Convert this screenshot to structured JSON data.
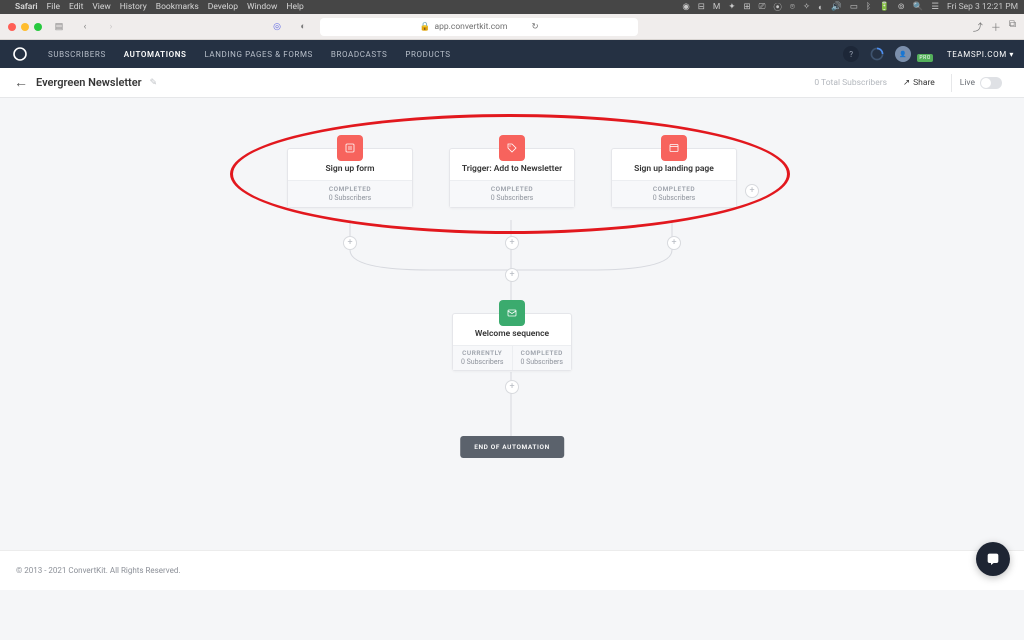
{
  "mac": {
    "app": "Safari",
    "menus": [
      "File",
      "Edit",
      "View",
      "History",
      "Bookmarks",
      "Develop",
      "Window",
      "Help"
    ],
    "clock": "Fri Sep 3  12:21 PM"
  },
  "browser": {
    "url": "app.convertkit.com"
  },
  "nav": {
    "items": [
      "SUBSCRIBERS",
      "AUTOMATIONS",
      "LANDING PAGES & FORMS",
      "BROADCASTS",
      "PRODUCTS"
    ],
    "account": "TEAMSPI.COM",
    "badge": "PRO"
  },
  "page": {
    "title": "Evergreen Newsletter",
    "subscribers": "0 Total Subscribers",
    "share": "Share",
    "live": "Live"
  },
  "triggers": [
    {
      "title": "Sign up form",
      "status": "COMPLETED",
      "count": "0 Subscribers"
    },
    {
      "title": "Trigger: Add to Newsletter",
      "status": "COMPLETED",
      "count": "0 Subscribers"
    },
    {
      "title": "Sign up landing page",
      "status": "COMPLETED",
      "count": "0 Subscribers"
    }
  ],
  "sequence": {
    "title": "Welcome sequence",
    "left_label": "CURRENTLY",
    "left_val": "0 Subscribers",
    "right_label": "COMPLETED",
    "right_val": "0 Subscribers"
  },
  "end": "END OF AUTOMATION",
  "footer": "© 2013 - 2021 ConvertKit. All Rights Reserved."
}
